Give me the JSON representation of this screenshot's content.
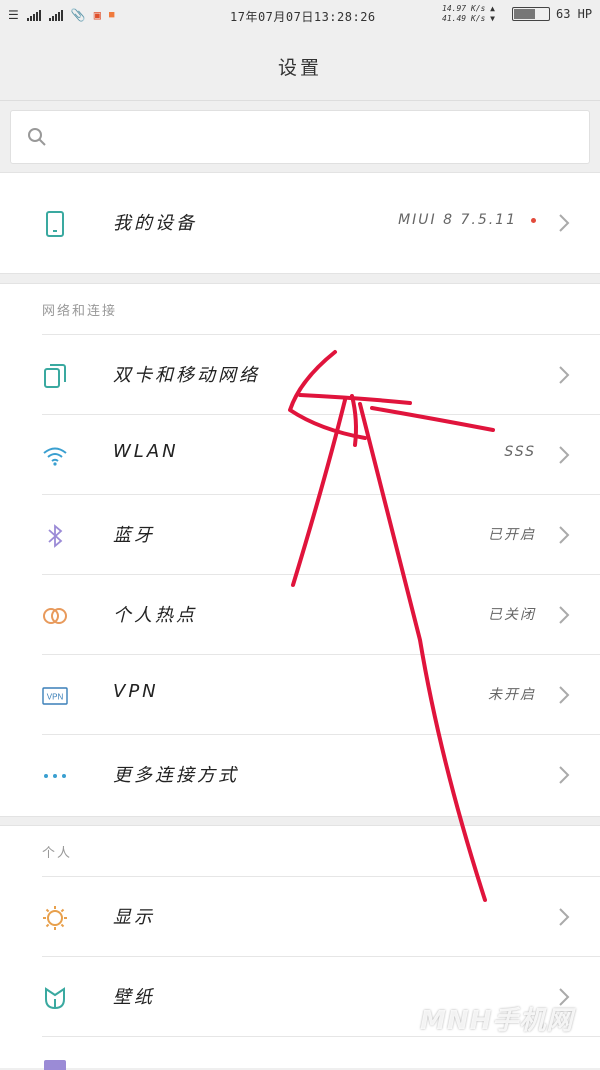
{
  "status_bar": {
    "datetime": "17年07月07日13:28:26",
    "speed_up": "14.97 K/s",
    "speed_down": "41.49 K/s",
    "battery_level": 0.63,
    "battery_text": "63 HP"
  },
  "title": "设置",
  "search": {
    "placeholder": ""
  },
  "device_row": {
    "label": "我的设备",
    "value": "MIUI 8 7.5.11"
  },
  "network_section": {
    "title": "网络和连接",
    "items": [
      {
        "label": "双卡和移动网络",
        "value": "",
        "icon": "sim-cards-icon"
      },
      {
        "label": "WLAN",
        "value": "SSS",
        "icon": "wifi-icon"
      },
      {
        "label": "蓝牙",
        "value": "已开启",
        "icon": "bluetooth-icon"
      },
      {
        "label": "个人热点",
        "value": "已关闭",
        "icon": "hotspot-icon"
      },
      {
        "label": "VPN",
        "value": "未开启",
        "icon": "vpn-icon"
      },
      {
        "label": "更多连接方式",
        "value": "",
        "icon": "more-dots-icon"
      }
    ]
  },
  "personal_section": {
    "title": "个人",
    "items": [
      {
        "label": "显示",
        "value": "",
        "icon": "display-sun-icon"
      },
      {
        "label": "壁纸",
        "value": "",
        "icon": "wallpaper-tulip-icon"
      }
    ]
  },
  "colors": {
    "accent_teal": "#3aa9a0",
    "annotation_red": "#e0143c",
    "reddot": "#e24a3b"
  }
}
